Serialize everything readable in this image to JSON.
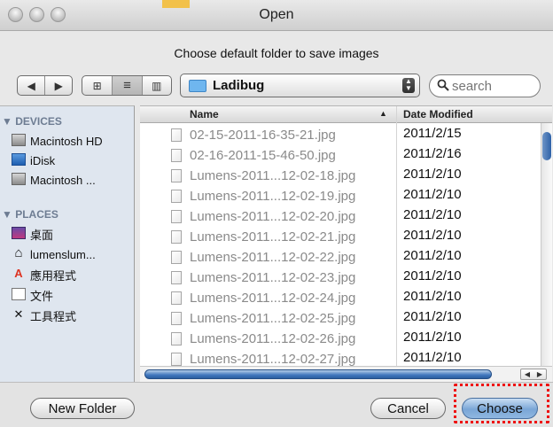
{
  "window": {
    "title": "Open",
    "subtitle": "Choose default folder to save images"
  },
  "toolbar": {
    "back_label": "◀",
    "forward_label": "▶",
    "view_icon": "⊞",
    "view_list": "≡",
    "view_columns": "▥",
    "location": "Ladibug",
    "search_placeholder": "search",
    "search_value": ""
  },
  "sidebar": {
    "devices_header": "DEVICES",
    "places_header": "PLACES",
    "devices": [
      {
        "label": "Macintosh HD",
        "icon": "hard-drive-icon"
      },
      {
        "label": "iDisk",
        "icon": "idisk-icon"
      },
      {
        "label": "Macintosh ...",
        "icon": "hard-drive-icon"
      }
    ],
    "places": [
      {
        "label": "桌面",
        "icon": "desktop-icon"
      },
      {
        "label": "lumenslum...",
        "icon": "home-icon"
      },
      {
        "label": "應用程式",
        "icon": "applications-icon"
      },
      {
        "label": "文件",
        "icon": "documents-icon"
      },
      {
        "label": "工具程式",
        "icon": "utilities-icon"
      }
    ]
  },
  "table": {
    "col_name": "Name",
    "col_date": "Date Modified",
    "sort_indicator": "▲",
    "rows": [
      {
        "name": "02-15-2011-16-35-21.jpg",
        "date": "2011/2/15"
      },
      {
        "name": "02-16-2011-15-46-50.jpg",
        "date": "2011/2/16"
      },
      {
        "name": "Lumens-2011...12-02-18.jpg",
        "date": "2011/2/10"
      },
      {
        "name": "Lumens-2011...12-02-19.jpg",
        "date": "2011/2/10"
      },
      {
        "name": "Lumens-2011...12-02-20.jpg",
        "date": "2011/2/10"
      },
      {
        "name": "Lumens-2011...12-02-21.jpg",
        "date": "2011/2/10"
      },
      {
        "name": "Lumens-2011...12-02-22.jpg",
        "date": "2011/2/10"
      },
      {
        "name": "Lumens-2011...12-02-23.jpg",
        "date": "2011/2/10"
      },
      {
        "name": "Lumens-2011...12-02-24.jpg",
        "date": "2011/2/10"
      },
      {
        "name": "Lumens-2011...12-02-25.jpg",
        "date": "2011/2/10"
      },
      {
        "name": "Lumens-2011...12-02-26.jpg",
        "date": "2011/2/10"
      },
      {
        "name": "Lumens-2011...12-02-27.jpg",
        "date": "2011/2/10"
      }
    ],
    "scroll_left": "◀",
    "scroll_right": "▶"
  },
  "buttons": {
    "new_folder": "New Folder",
    "cancel": "Cancel",
    "choose": "Choose"
  },
  "colors": {
    "highlight": "#e11111",
    "accent": "#3f76bd"
  }
}
